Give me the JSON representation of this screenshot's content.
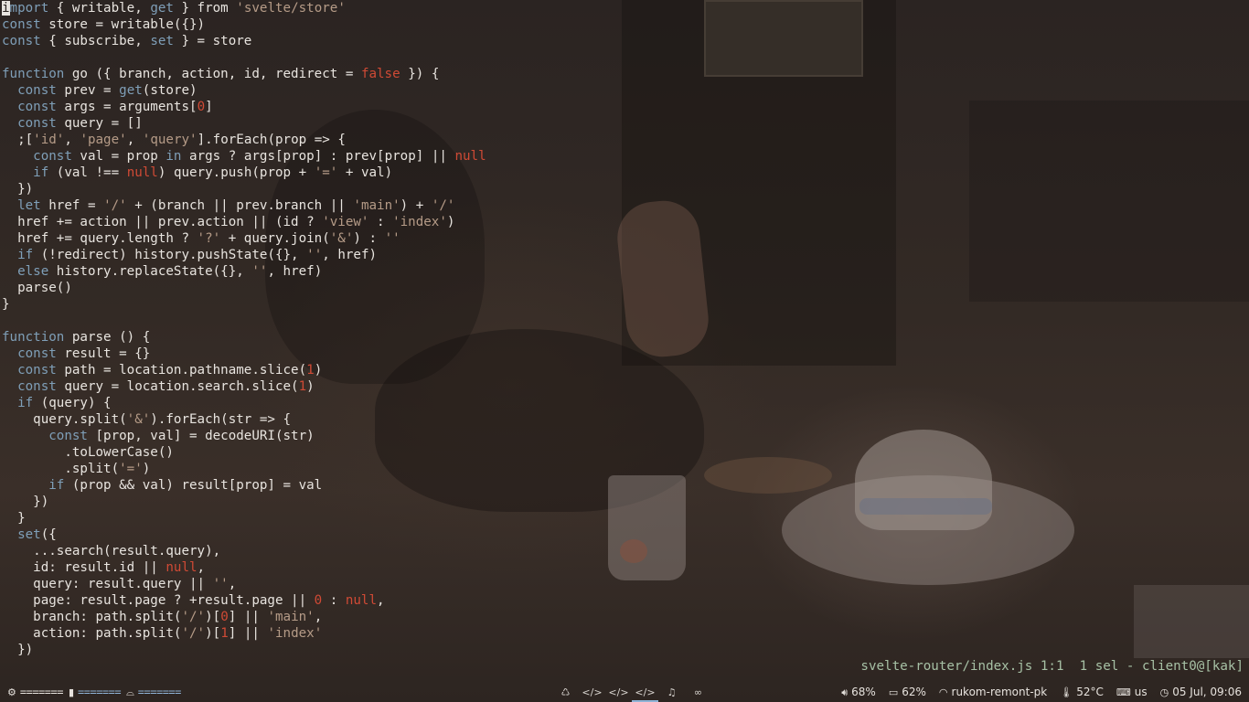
{
  "editor": {
    "lines": [
      {
        "parts": [
          {
            "t": "i",
            "c": "cursor"
          },
          {
            "t": "mport",
            "c": "kw"
          },
          {
            "t": " { writable, "
          },
          {
            "t": "get",
            "c": "kw"
          },
          {
            "t": " } from "
          },
          {
            "t": "'svelte/store'",
            "c": "st"
          }
        ]
      },
      {
        "parts": [
          {
            "t": "const",
            "c": "kw"
          },
          {
            "t": " store = writable({})"
          }
        ]
      },
      {
        "parts": [
          {
            "t": "const",
            "c": "kw"
          },
          {
            "t": " { subscribe, "
          },
          {
            "t": "set",
            "c": "kw"
          },
          {
            "t": " } = store"
          }
        ]
      },
      {
        "parts": []
      },
      {
        "parts": [
          {
            "t": "function",
            "c": "kw"
          },
          {
            "t": " go ({ branch, action, id, redirect = "
          },
          {
            "t": "false",
            "c": "nu"
          },
          {
            "t": " }) {"
          }
        ]
      },
      {
        "parts": [
          {
            "t": "  "
          },
          {
            "t": "const",
            "c": "kw"
          },
          {
            "t": " prev = "
          },
          {
            "t": "get",
            "c": "kw"
          },
          {
            "t": "(store)"
          }
        ]
      },
      {
        "parts": [
          {
            "t": "  "
          },
          {
            "t": "const",
            "c": "kw"
          },
          {
            "t": " args = arguments["
          },
          {
            "t": "0",
            "c": "nu"
          },
          {
            "t": "]"
          }
        ]
      },
      {
        "parts": [
          {
            "t": "  "
          },
          {
            "t": "const",
            "c": "kw"
          },
          {
            "t": " query = []"
          }
        ]
      },
      {
        "parts": [
          {
            "t": "  ;["
          },
          {
            "t": "'id'",
            "c": "st"
          },
          {
            "t": ", "
          },
          {
            "t": "'page'",
            "c": "st"
          },
          {
            "t": ", "
          },
          {
            "t": "'query'",
            "c": "st"
          },
          {
            "t": "].forEach(prop => {"
          }
        ]
      },
      {
        "parts": [
          {
            "t": "    "
          },
          {
            "t": "const",
            "c": "kw"
          },
          {
            "t": " val = prop "
          },
          {
            "t": "in",
            "c": "kw"
          },
          {
            "t": " args ? args[prop] : prev[prop] || "
          },
          {
            "t": "null",
            "c": "nu"
          }
        ]
      },
      {
        "parts": [
          {
            "t": "    "
          },
          {
            "t": "if",
            "c": "kw"
          },
          {
            "t": " (val !== "
          },
          {
            "t": "null",
            "c": "nu"
          },
          {
            "t": ") query.push(prop + "
          },
          {
            "t": "'='",
            "c": "st"
          },
          {
            "t": " + val)"
          }
        ]
      },
      {
        "parts": [
          {
            "t": "  })"
          }
        ]
      },
      {
        "parts": [
          {
            "t": "  "
          },
          {
            "t": "let",
            "c": "kw"
          },
          {
            "t": " href = "
          },
          {
            "t": "'/'",
            "c": "st"
          },
          {
            "t": " + (branch || prev.branch || "
          },
          {
            "t": "'main'",
            "c": "st"
          },
          {
            "t": ") + "
          },
          {
            "t": "'/'",
            "c": "st"
          }
        ]
      },
      {
        "parts": [
          {
            "t": "  href += action || prev.action || (id ? "
          },
          {
            "t": "'view'",
            "c": "st"
          },
          {
            "t": " : "
          },
          {
            "t": "'index'",
            "c": "st"
          },
          {
            "t": ")"
          }
        ]
      },
      {
        "parts": [
          {
            "t": "  href += query.length ? "
          },
          {
            "t": "'?'",
            "c": "st"
          },
          {
            "t": " + query.join("
          },
          {
            "t": "'&'",
            "c": "st"
          },
          {
            "t": ") : "
          },
          {
            "t": "''",
            "c": "st"
          }
        ]
      },
      {
        "parts": [
          {
            "t": "  "
          },
          {
            "t": "if",
            "c": "kw"
          },
          {
            "t": " (!redirect) history.pushState({}, "
          },
          {
            "t": "''",
            "c": "st"
          },
          {
            "t": ", href)"
          }
        ]
      },
      {
        "parts": [
          {
            "t": "  "
          },
          {
            "t": "else",
            "c": "kw"
          },
          {
            "t": " history.replaceState({}, "
          },
          {
            "t": "''",
            "c": "st"
          },
          {
            "t": ", href)"
          }
        ]
      },
      {
        "parts": [
          {
            "t": "  parse()"
          }
        ]
      },
      {
        "parts": [
          {
            "t": "}"
          }
        ]
      },
      {
        "parts": []
      },
      {
        "parts": [
          {
            "t": "function",
            "c": "kw"
          },
          {
            "t": " parse () {"
          }
        ]
      },
      {
        "parts": [
          {
            "t": "  "
          },
          {
            "t": "const",
            "c": "kw"
          },
          {
            "t": " result = {}"
          }
        ]
      },
      {
        "parts": [
          {
            "t": "  "
          },
          {
            "t": "const",
            "c": "kw"
          },
          {
            "t": " path = location.pathname.slice("
          },
          {
            "t": "1",
            "c": "nu"
          },
          {
            "t": ")"
          }
        ]
      },
      {
        "parts": [
          {
            "t": "  "
          },
          {
            "t": "const",
            "c": "kw"
          },
          {
            "t": " query = location.search.slice("
          },
          {
            "t": "1",
            "c": "nu"
          },
          {
            "t": ")"
          }
        ]
      },
      {
        "parts": [
          {
            "t": "  "
          },
          {
            "t": "if",
            "c": "kw"
          },
          {
            "t": " (query) {"
          }
        ]
      },
      {
        "parts": [
          {
            "t": "    query.split("
          },
          {
            "t": "'&'",
            "c": "st"
          },
          {
            "t": ").forEach(str => {"
          }
        ]
      },
      {
        "parts": [
          {
            "t": "      "
          },
          {
            "t": "const",
            "c": "kw"
          },
          {
            "t": " [prop, val] = decodeURI(str)"
          }
        ]
      },
      {
        "parts": [
          {
            "t": "        .toLowerCase()"
          }
        ]
      },
      {
        "parts": [
          {
            "t": "        .split("
          },
          {
            "t": "'='",
            "c": "st"
          },
          {
            "t": ")"
          }
        ]
      },
      {
        "parts": [
          {
            "t": "      "
          },
          {
            "t": "if",
            "c": "kw"
          },
          {
            "t": " (prop && val) result[prop] = val"
          }
        ]
      },
      {
        "parts": [
          {
            "t": "    })"
          }
        ]
      },
      {
        "parts": [
          {
            "t": "  }"
          }
        ]
      },
      {
        "parts": [
          {
            "t": "  "
          },
          {
            "t": "set",
            "c": "kw"
          },
          {
            "t": "({"
          }
        ]
      },
      {
        "parts": [
          {
            "t": "    ...search(result.query),"
          }
        ]
      },
      {
        "parts": [
          {
            "t": "    id: result.id || "
          },
          {
            "t": "null",
            "c": "nu"
          },
          {
            "t": ","
          }
        ]
      },
      {
        "parts": [
          {
            "t": "    query: result.query || "
          },
          {
            "t": "''",
            "c": "st"
          },
          {
            "t": ","
          }
        ]
      },
      {
        "parts": [
          {
            "t": "    page: result.page ? +result.page || "
          },
          {
            "t": "0",
            "c": "nu"
          },
          {
            "t": " : "
          },
          {
            "t": "null",
            "c": "nu"
          },
          {
            "t": ","
          }
        ]
      },
      {
        "parts": [
          {
            "t": "    branch: path.split("
          },
          {
            "t": "'/'",
            "c": "st"
          },
          {
            "t": ")["
          },
          {
            "t": "0",
            "c": "nu"
          },
          {
            "t": "] || "
          },
          {
            "t": "'main'",
            "c": "st"
          },
          {
            "t": ","
          }
        ]
      },
      {
        "parts": [
          {
            "t": "    action: path.split("
          },
          {
            "t": "'/'",
            "c": "st"
          },
          {
            "t": ")["
          },
          {
            "t": "1",
            "c": "nu"
          },
          {
            "t": "] || "
          },
          {
            "t": "'index'",
            "c": "st"
          }
        ]
      },
      {
        "parts": [
          {
            "t": "  })"
          }
        ]
      }
    ]
  },
  "statusline": {
    "file": "svelte-router/index.js",
    "position": "1:1",
    "selection": "1 sel",
    "client": "client0@[kak]"
  },
  "bar": {
    "left": {
      "cpu_icon": "gear-icon",
      "cpu_meter": "=======",
      "mem_icon": "memory-icon",
      "mem_meter": "=======",
      "disk_icon": "disk-icon",
      "disk_meter": "======="
    },
    "workspaces": [
      {
        "icon": "recycle-icon",
        "glyph": "♺",
        "active": false
      },
      {
        "icon": "code-icon",
        "glyph": "</>",
        "active": false
      },
      {
        "icon": "code-icon",
        "glyph": "</>",
        "active": false
      },
      {
        "icon": "code-icon",
        "glyph": "</>",
        "active": true
      },
      {
        "icon": "music-icon",
        "glyph": "♫",
        "active": false
      },
      {
        "icon": "glasses-icon",
        "glyph": "∞",
        "active": false
      }
    ],
    "right": {
      "volume": "68%",
      "battery": "62%",
      "wifi": "rukom-remont-pk",
      "temperature": "52°C",
      "layout": "us",
      "clock": "05 Jul, 09:06"
    }
  }
}
